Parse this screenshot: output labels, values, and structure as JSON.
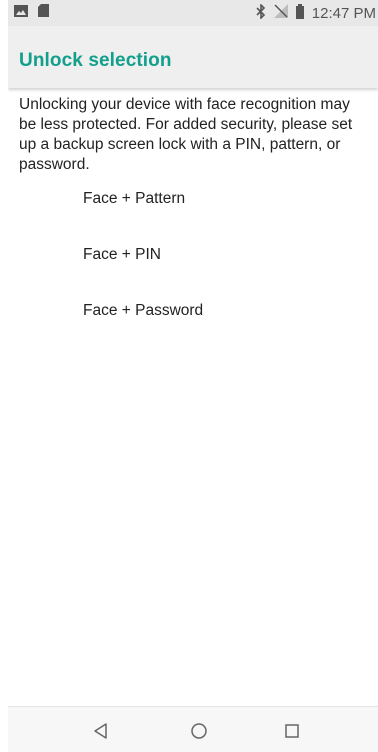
{
  "status_bar": {
    "time": "12:47 PM",
    "icons": [
      "image-notification-icon",
      "sd-card-icon",
      "bluetooth-icon",
      "no-signal-icon",
      "battery-icon"
    ]
  },
  "header": {
    "title": "Unlock selection"
  },
  "description": "Unlocking your device with face recognition may be less protected. For added security, please set up a backup screen lock with a PIN, pattern, or password.",
  "options": [
    {
      "label": "Face + Pattern"
    },
    {
      "label": "Face + PIN"
    },
    {
      "label": "Face + Password"
    }
  ],
  "navigation": {
    "buttons": [
      "back-icon",
      "home-icon",
      "recents-icon"
    ]
  },
  "colors": {
    "accent": "#129f8c",
    "status_bar": "#e8e8e8",
    "app_bar": "#efefef"
  }
}
